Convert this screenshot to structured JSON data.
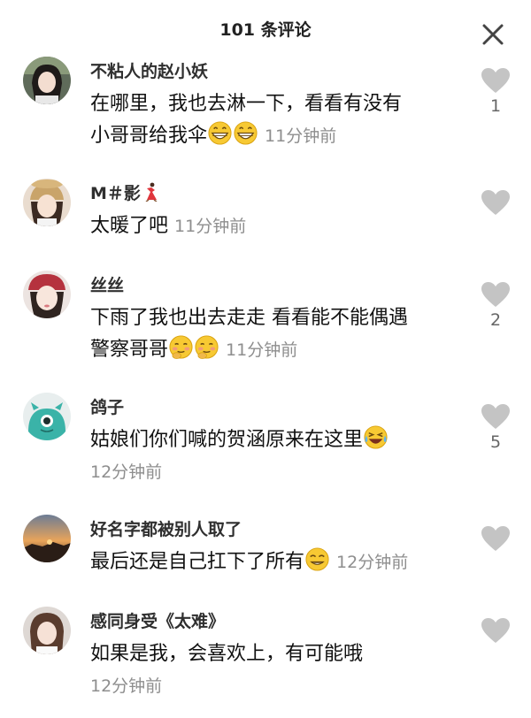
{
  "header": {
    "title": "101 条评论",
    "close_icon": "close-icon"
  },
  "comments": [
    {
      "username": "不粘人的赵小妖",
      "text_line1": "在哪里，我也去淋一下，看看有没有",
      "text_line2": "小哥哥给我伞",
      "emojis": [
        "grin-emoji",
        "grin-emoji"
      ],
      "time": "11分钟前",
      "like_count": "1"
    },
    {
      "username": "M＃影",
      "username_emoji": "dancer-emoji",
      "text": "太暖了吧",
      "time": "11分钟前",
      "like_count": ""
    },
    {
      "username": "丝丝",
      "text_line1": "下雨了我也出去走走 看看能不能偶遇",
      "text_line2": "警察哥哥",
      "emojis": [
        "shy-emoji",
        "shy-emoji"
      ],
      "time": "11分钟前",
      "like_count": "2"
    },
    {
      "username": "鸽子",
      "text": "姑娘们你们喊的贺涵原来在这里",
      "emojis": [
        "laugh-cry-emoji"
      ],
      "time": "12分钟前",
      "like_count": "5"
    },
    {
      "username": "好名字都被别人取了",
      "text": "最后还是自己扛下了所有",
      "emojis": [
        "smirk-emoji"
      ],
      "time": "12分钟前",
      "like_count": ""
    },
    {
      "username": "感同身受《太难》",
      "text": "如果是我，会喜欢上，有可能哦",
      "time": "12分钟前",
      "like_count": ""
    }
  ],
  "colors": {
    "username": "#2f2f2f",
    "timestamp": "#8e8e8e",
    "heart": "#c4c4c4",
    "emoji_face": "#f7c933"
  }
}
